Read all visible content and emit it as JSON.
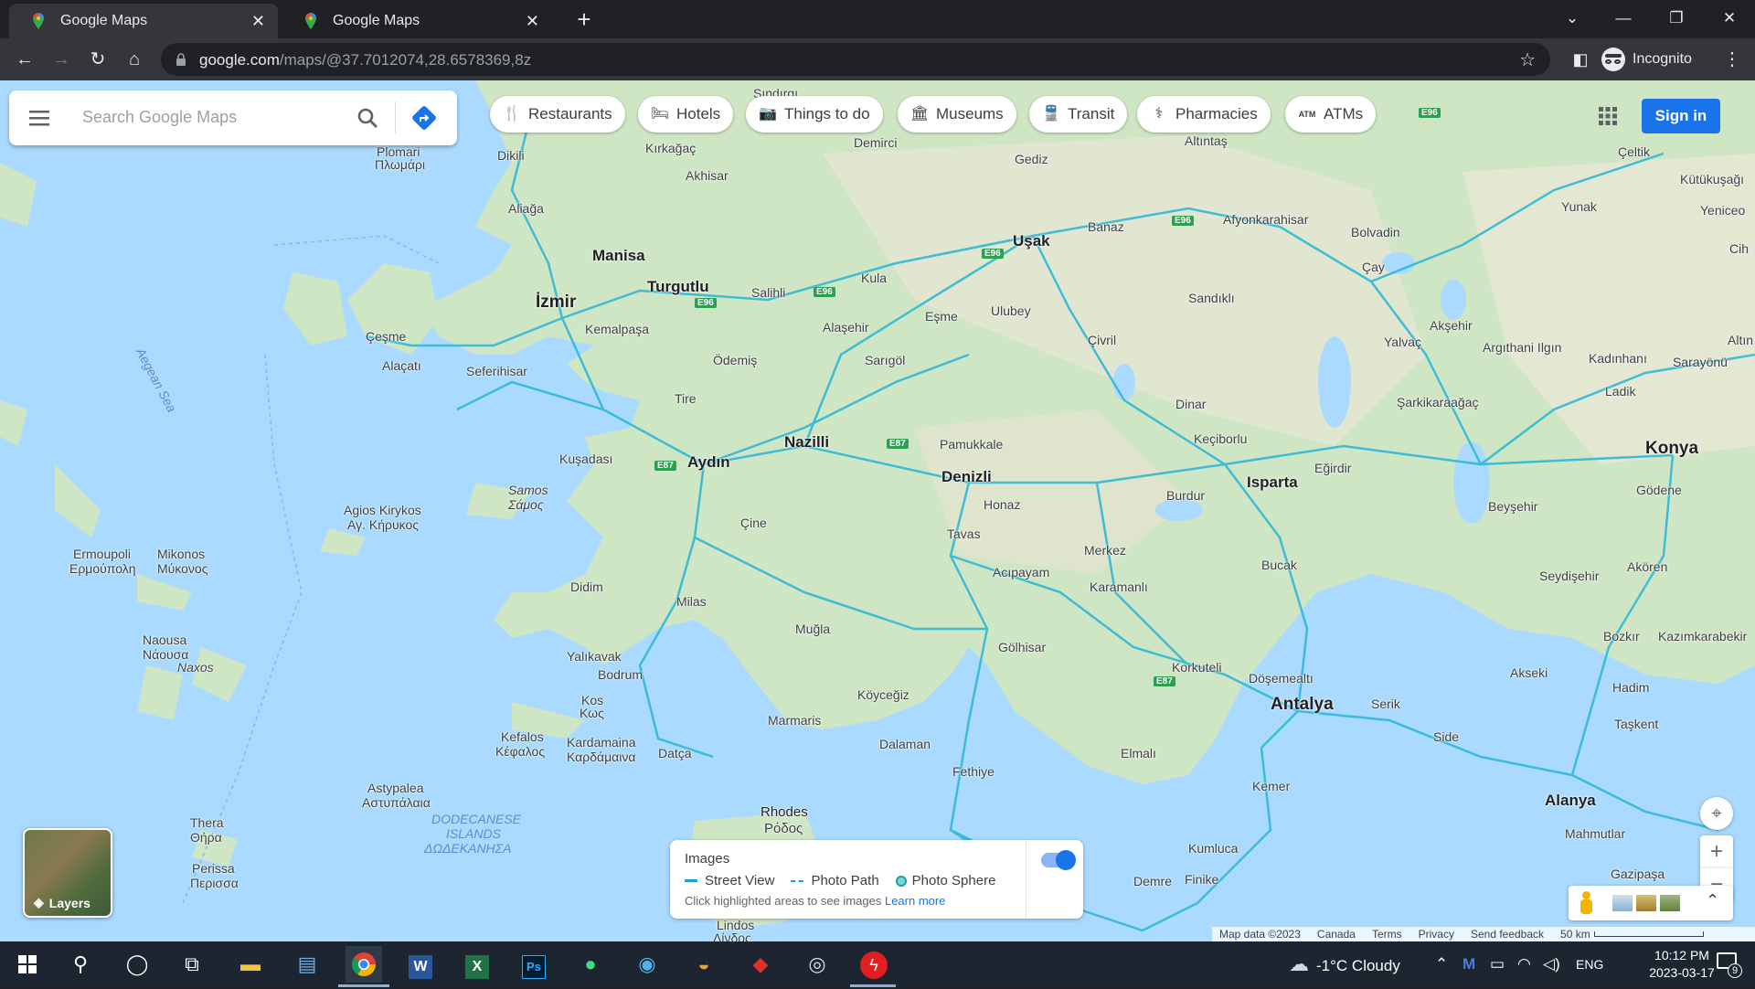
{
  "browser": {
    "tabs": [
      {
        "title": "Google Maps",
        "close": "✕"
      },
      {
        "title": "Google Maps",
        "close": "✕"
      }
    ],
    "new_tab": "+",
    "url_host": "google.com",
    "url_path": "/maps/@37.7012074,28.6578369,8z",
    "profile": "Incognito"
  },
  "search": {
    "placeholder": "Search Google Maps"
  },
  "chips": [
    {
      "label": "Restaurants",
      "icon": "restaurant-icon"
    },
    {
      "label": "Hotels",
      "icon": "hotel-icon"
    },
    {
      "label": "Things to do",
      "icon": "camera-icon"
    },
    {
      "label": "Museums",
      "icon": "museum-icon"
    },
    {
      "label": "Transit",
      "icon": "train-icon"
    },
    {
      "label": "Pharmacies",
      "icon": "pharmacy-icon"
    },
    {
      "label": "ATMs",
      "icon": "atm-icon"
    }
  ],
  "signin": "Sign in",
  "map_labels": {
    "izmir": "İzmir",
    "manisa": "Manisa",
    "turgutlu": "Turgutlu",
    "kemalpasa": "Kemalpaşa",
    "cesme": "Çeşme",
    "alacati": "Alaçatı",
    "seferihisar": "Seferihisar",
    "odemis": "Ödemiş",
    "tire": "Tire",
    "kusadasi": "Kuşadası",
    "aydin": "Aydın",
    "nazilli": "Nazilli",
    "denizli": "Denizli",
    "pamukkale": "Pamukkale",
    "honaz": "Honaz",
    "tavas": "Tavas",
    "cine": "Çine",
    "didim": "Didim",
    "milas": "Milas",
    "mugla": "Muğla",
    "bodrum": "Bodrum",
    "yalikavak": "Yalıkavak",
    "marmaris": "Marmaris",
    "dalaman": "Dalaman",
    "fethiye": "Fethiye",
    "koycegiz": "Köyceğiz",
    "datca": "Datça",
    "usak": "Uşak",
    "banaz": "Banaz",
    "esme": "Eşme",
    "ulubey": "Ulubey",
    "kula": "Kula",
    "salihli": "Salihli",
    "alasehir": "Alaşehir",
    "sarigol": "Sarıgöl",
    "civril": "Çivril",
    "dinar": "Dinar",
    "sandikli": "Sandıklı",
    "afyon": "Afyonkarahisar",
    "bolvadin": "Bolvadin",
    "cay": "Çay",
    "aksehir": "Akşehir",
    "yalvac": "Yalvaç",
    "isparta": "Isparta",
    "egirdir": "Eğirdir",
    "keciborlu": "Keçiborlu",
    "burdur": "Burdur",
    "bucak": "Bucak",
    "merkez": "Merkez",
    "karamanli": "Karamanlı",
    "acipayam": "Acıpayam",
    "golhisar": "Gölhisar",
    "korkuteli": "Korkuteli",
    "antalya": "Antalya",
    "dosemealti": "Döşemealtı",
    "serik": "Serik",
    "side": "Side",
    "manavgat": "Akseki",
    "alanya": "Alanya",
    "mahmutlar": "Mahmutlar",
    "gazipasa": "Gazipaşa",
    "kemer": "Kemer",
    "kumluca": "Kumluca",
    "finike": "Finike",
    "demre": "Demre",
    "elmali": "Elmalı",
    "konya": "Konya",
    "godene": "Gödene",
    "beysehir": "Beyşehir",
    "seydisehir": "Seydişehir",
    "akoren": "Akören",
    "bozkir": "Bozkır",
    "hadim": "Hadim",
    "taskent": "Taşkent",
    "kazimkarabekir": "Kazımkarabekir",
    "sarkikaraagac": "Şarkikaraağaç",
    "ilgin": "Argıthani Ilgın",
    "kadinhani": "Kadınhanı",
    "sarayonu": "Sarayönü",
    "ladik": "Ladik",
    "yunak": "Yunak",
    "celtik": "Çeltik",
    "kutukusagi": "Kütükuşağı",
    "yeniceo": "Yeniceo",
    "cih": "Cih",
    "altin": "Altın",
    "gediz": "Gediz",
    "altintas": "Altıntaş",
    "simav": "Sındırgı",
    "demirci": "Demirci",
    "akhisar": "Akhisar",
    "kirkagac": "Kırkağaç",
    "dikili": "Dikili",
    "aliaga": "Aliağa",
    "plomari": "Plomari",
    "plomari_gr": "Πλωμάρι",
    "samos": "Samos",
    "samos_gr": "Σάμος",
    "agios": "Agios Kirykos",
    "agios_gr": "Αγ. Κήρυκος",
    "ermoupoli": "Ermoupoli",
    "ermoupoli_gr": "Ερμούπολη",
    "mikonos": "Mikonos",
    "mikonos_gr": "Μύκονος",
    "naousa": "Naousa",
    "naousa_gr": "Νάουσα",
    "naxos": "Naxos",
    "kos": "Kos",
    "kos_gr": "Κως",
    "kefalos": "Kefalos",
    "kefalos_gr": "Κέφαλος",
    "kardamaina": "Kardamaina",
    "kardamaina_gr": "Καρδάμαινα",
    "astypalea": "Astypalea",
    "astypalea_gr": "Αστυπάλαια",
    "thera": "Thera",
    "thera_gr": "Θήρα",
    "perissa": "Perissa",
    "perissa_gr": "Περισσα",
    "rhodes": "Rhodes",
    "rhodes_gr": "Ρόδος",
    "lindos": "Lindos",
    "lindos_gr": "Λίνδος",
    "dodecanese": "DODECANESE",
    "islands": "ISLANDS",
    "dodec_gr": "ΔΩΔΕΚΑΝΗΣΑ",
    "aegean": "Aegean Sea",
    "merkez2": "Merkez"
  },
  "road_shields": [
    "E96",
    "E96",
    "E96",
    "E96",
    "E96",
    "E87",
    "E87",
    "E87"
  ],
  "layers": {
    "label": "Layers"
  },
  "images_panel": {
    "title": "Images",
    "street_view": "Street View",
    "photo_path": "Photo Path",
    "photo_sphere": "Photo Sphere",
    "hint": "Click highlighted areas to see images",
    "learn_more": "Learn more"
  },
  "zoom": {
    "in": "+",
    "out": "−"
  },
  "footer": {
    "map_data": "Map data ©2023",
    "country": "Canada",
    "terms": "Terms",
    "privacy": "Privacy",
    "feedback": "Send feedback",
    "scale": "50 km"
  },
  "taskbar": {
    "weather": "-1°C  Cloudy",
    "lang": "ENG",
    "time": "10:12 PM",
    "date": "2023-03-17",
    "notif_count": "9"
  },
  "colors": {
    "accent": "#1a73e8",
    "road": "#2fb8d8",
    "water": "#aadaff",
    "land": "#cfe6c4"
  }
}
